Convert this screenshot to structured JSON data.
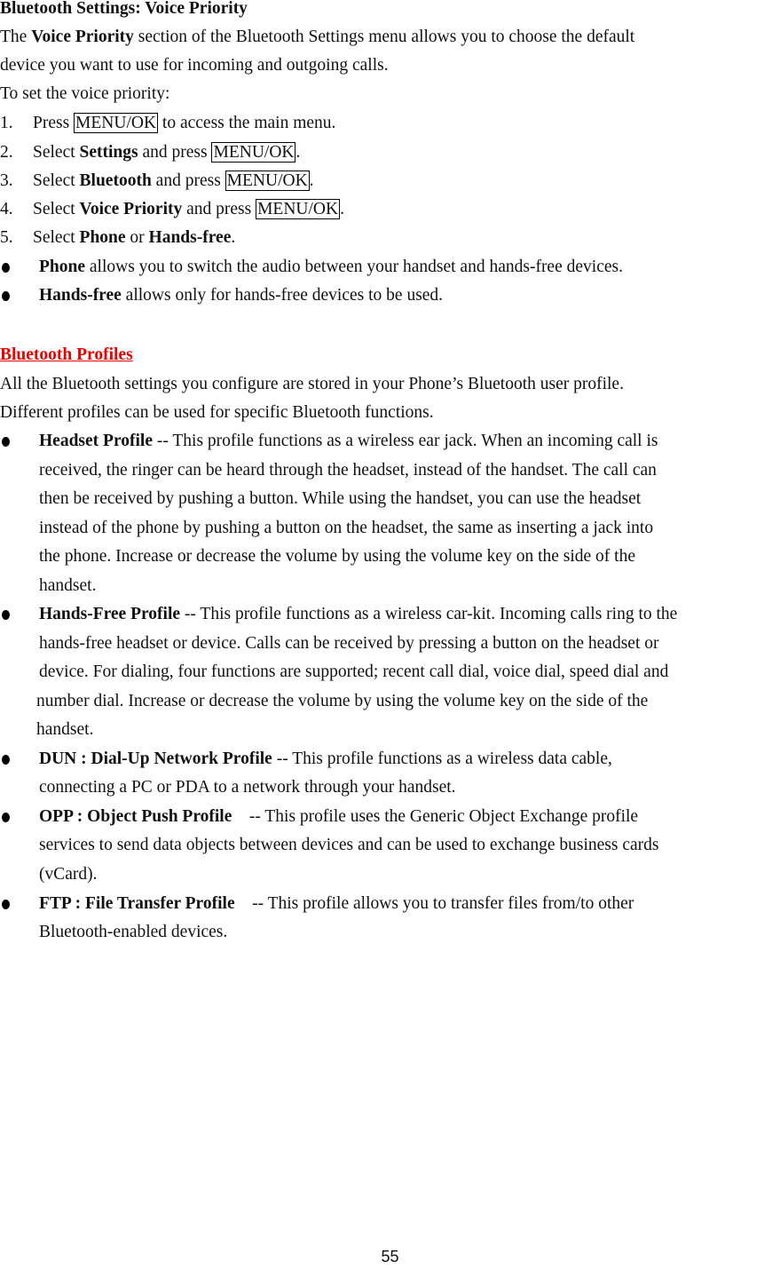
{
  "title": "Bluetooth Settings: Voice Priority",
  "intro": {
    "pre": "The ",
    "bold": "Voice Priority",
    "post": " section of the Bluetooth Settings menu allows you to choose the default",
    "line2": "device you want to use for incoming and outgoing calls."
  },
  "steps_intro": "To set the voice priority:",
  "key_label": "MENU/OK",
  "steps": [
    {
      "num": "1.",
      "pre": "Press ",
      "post": " to access the main menu."
    },
    {
      "num": "2.",
      "pre": "Select ",
      "bold": "Settings",
      "mid": " and press ",
      "post": "."
    },
    {
      "num": "3.",
      "pre": "Select ",
      "bold": "Bluetooth",
      "mid": " and press ",
      "post": "."
    },
    {
      "num": "4.",
      "pre": "Select ",
      "bold": "Voice Priority",
      "mid": " and press ",
      "post": "."
    },
    {
      "num": "5.",
      "pre": "Select ",
      "bold": "Phone",
      "mid": " or ",
      "bold2": "Hands-free",
      "post": "."
    }
  ],
  "options": [
    {
      "bold": "Phone",
      "text": " allows you to switch the audio between your handset and hands-free devices."
    },
    {
      "bold": "Hands-free",
      "text": " allows only for hands-free devices to be used."
    }
  ],
  "profiles_heading": "Bluetooth Profiles",
  "profiles_heading_color": "#ee0000",
  "profiles_intro": [
    "All the Bluetooth settings you configure are stored in your Phone’s Bluetooth user profile.",
    "Different profiles can be used for specific Bluetooth functions."
  ],
  "profiles": [
    {
      "bold": "Headset Profile",
      "lines": [
        " -- This profile functions as a wireless ear jack. When an incoming call is",
        "received, the ringer can be heard through the headset, instead of the handset. The call can",
        "then be received by pushing a button. While using the handset, you can use the headset",
        "instead of the phone by pushing a button on the headset, the same as inserting a jack into",
        "the phone. Increase or decrease the volume by using the volume key on the side of the",
        "handset."
      ]
    },
    {
      "bold": "Hands-Free Profile",
      "lines": [
        " -- This profile functions as a wireless car-kit. Incoming calls ring to the",
        "hands-free headset or device. Calls can be received by pressing a button on the headset or",
        "device. For dialing, four functions are supported; recent call dial, voice dial, speed dial and",
        "number dial. Increase or decrease the volume by using the volume key on the side of the",
        "handset."
      ]
    },
    {
      "bold": "DUN : Dial-Up Network Profile",
      "lines": [
        " -- This profile functions as a wireless data cable,",
        "connecting a PC or PDA to a network through your handset."
      ]
    },
    {
      "bold": "OPP : Object Push Profile",
      "lines": [
        "    -- This profile uses the Generic Object Exchange profile",
        "services to send data objects between devices and can be used to exchange business cards",
        "(vCard)."
      ]
    },
    {
      "bold": "FTP : File Transfer Profile",
      "lines": [
        "    -- This profile allows you to transfer files from/to other",
        "Bluetooth-enabled devices."
      ]
    }
  ],
  "page_number": "55"
}
